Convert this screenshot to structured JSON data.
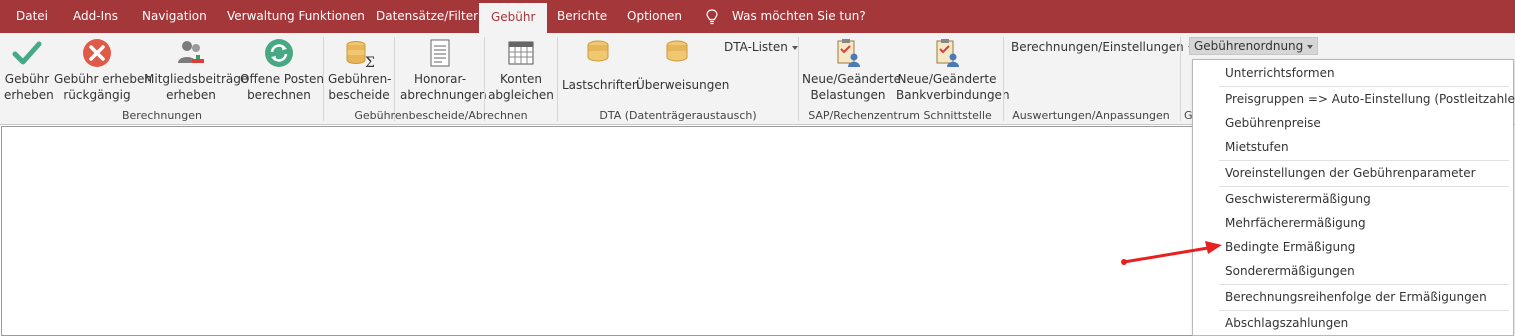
{
  "tabs": [
    "Datei",
    "Add-Ins",
    "Navigation",
    "Verwaltung Funktionen",
    "Datensätze/Filter",
    "Gebühr",
    "Berichte",
    "Optionen"
  ],
  "search": {
    "label": "Was möchten Sie tun?",
    "icon": "lightbulb-icon"
  },
  "ribbon": {
    "groups": {
      "berechnungen": "Berechnungen",
      "bescheide": "Gebührenbescheide/Abrechnen",
      "dta": "DTA (Datenträgeraustausch)",
      "sap": "SAP/Rechenzentrum Schnittstelle",
      "auswertungen": "Auswertungen/Anpassungen",
      "g": "G"
    },
    "buttons": {
      "erheben_1": "Gebühr",
      "erheben_2": "erheben",
      "rueck_1": "Gebühr erheben",
      "rueck_2": "rückgängig",
      "mitglied_1": "Mitgliedsbeiträge",
      "mitglied_2": "erheben",
      "offene_1": "Offene Posten",
      "offene_2": "berechnen",
      "bescheide_1": "Gebühren-",
      "bescheide_2": "bescheide",
      "honorar_1": "Honorar-",
      "honorar_2": "abrechnungen",
      "konten_1": "Konten",
      "konten_2": "abgleichen",
      "lastschriften": "Lastschriften",
      "ueberweisungen": "Überweisungen",
      "dta_listen": "DTA-Listen",
      "belast_1": "Neue/Geänderte",
      "belast_2": "Belastungen",
      "bank_1": "Neue/Geänderte",
      "bank_2": "Bankverbindungen",
      "berechnungen_einst": "Berechnungen/Einstellungen",
      "gebuehrenordnung": "Gebührenordnung"
    }
  },
  "menu": {
    "items": [
      "Unterrichtsformen",
      "Preisgruppen => Auto-Einstellung (Postleitzahlen)",
      "Gebührenpreise",
      "Mietstufen",
      "Voreinstellungen der Gebührenparameter",
      "Geschwisterermäßigung",
      "Mehrfächerermäßigung",
      "Bedingte Ermäßigung",
      "Sonderermäßigungen",
      "Berechnungsreihenfolge der Ermäßigungen",
      "Abschlagszahlungen"
    ]
  },
  "colors": {
    "accent": "#a4373a",
    "ribbon_bg": "#f3f3f3",
    "arrow": "#e8201f"
  }
}
